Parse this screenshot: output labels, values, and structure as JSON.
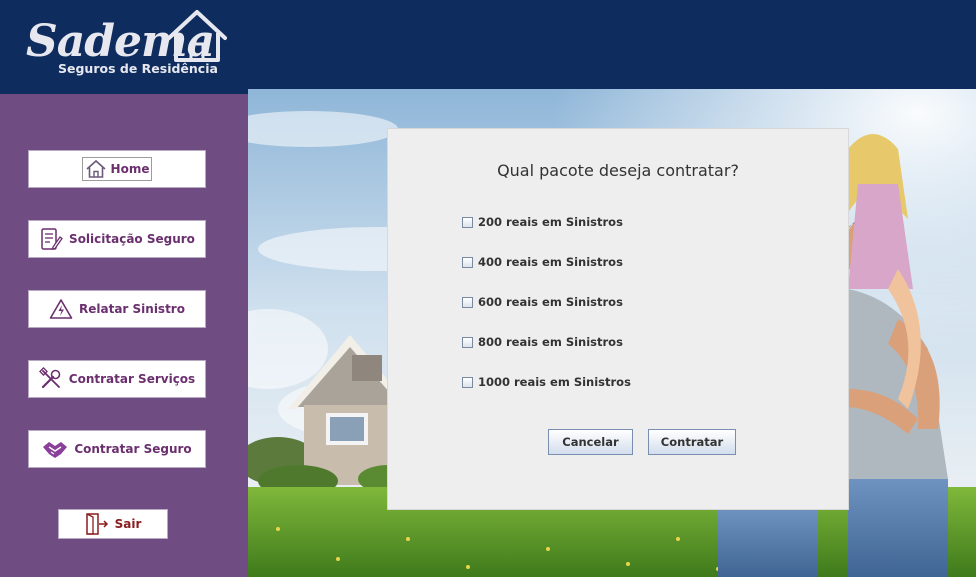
{
  "brand": {
    "name": "Sadema",
    "tagline": "Seguros de Residência"
  },
  "sidebar": {
    "items": [
      {
        "label": "Home",
        "icon": "home-icon"
      },
      {
        "label": "Solicitação Seguro",
        "icon": "form-pencil-icon"
      },
      {
        "label": "Relatar Sinistro",
        "icon": "warning-lightning-icon"
      },
      {
        "label": "Contratar Serviços",
        "icon": "tools-icon"
      },
      {
        "label": "Contratar Seguro",
        "icon": "handshake-icon"
      }
    ],
    "exit": {
      "label": "Sair",
      "icon": "exit-door-icon"
    }
  },
  "dialog": {
    "title": "Qual pacote deseja contratar?",
    "options": [
      {
        "label": "200 reais em Sinistros",
        "checked": false
      },
      {
        "label": "400 reais em Sinistros",
        "checked": false
      },
      {
        "label": "600 reais em Sinistros",
        "checked": false
      },
      {
        "label": "800 reais em Sinistros",
        "checked": false
      },
      {
        "label": "1000 reais em Sinistros",
        "checked": false
      }
    ],
    "cancel_label": "Cancelar",
    "confirm_label": "Contratar"
  },
  "colors": {
    "header": "#0e2c5e",
    "sidebar": "#6f4c82",
    "nav_text": "#6b2f6f",
    "exit_text": "#8a1c1c",
    "dialog_bg": "#eeeeee"
  }
}
